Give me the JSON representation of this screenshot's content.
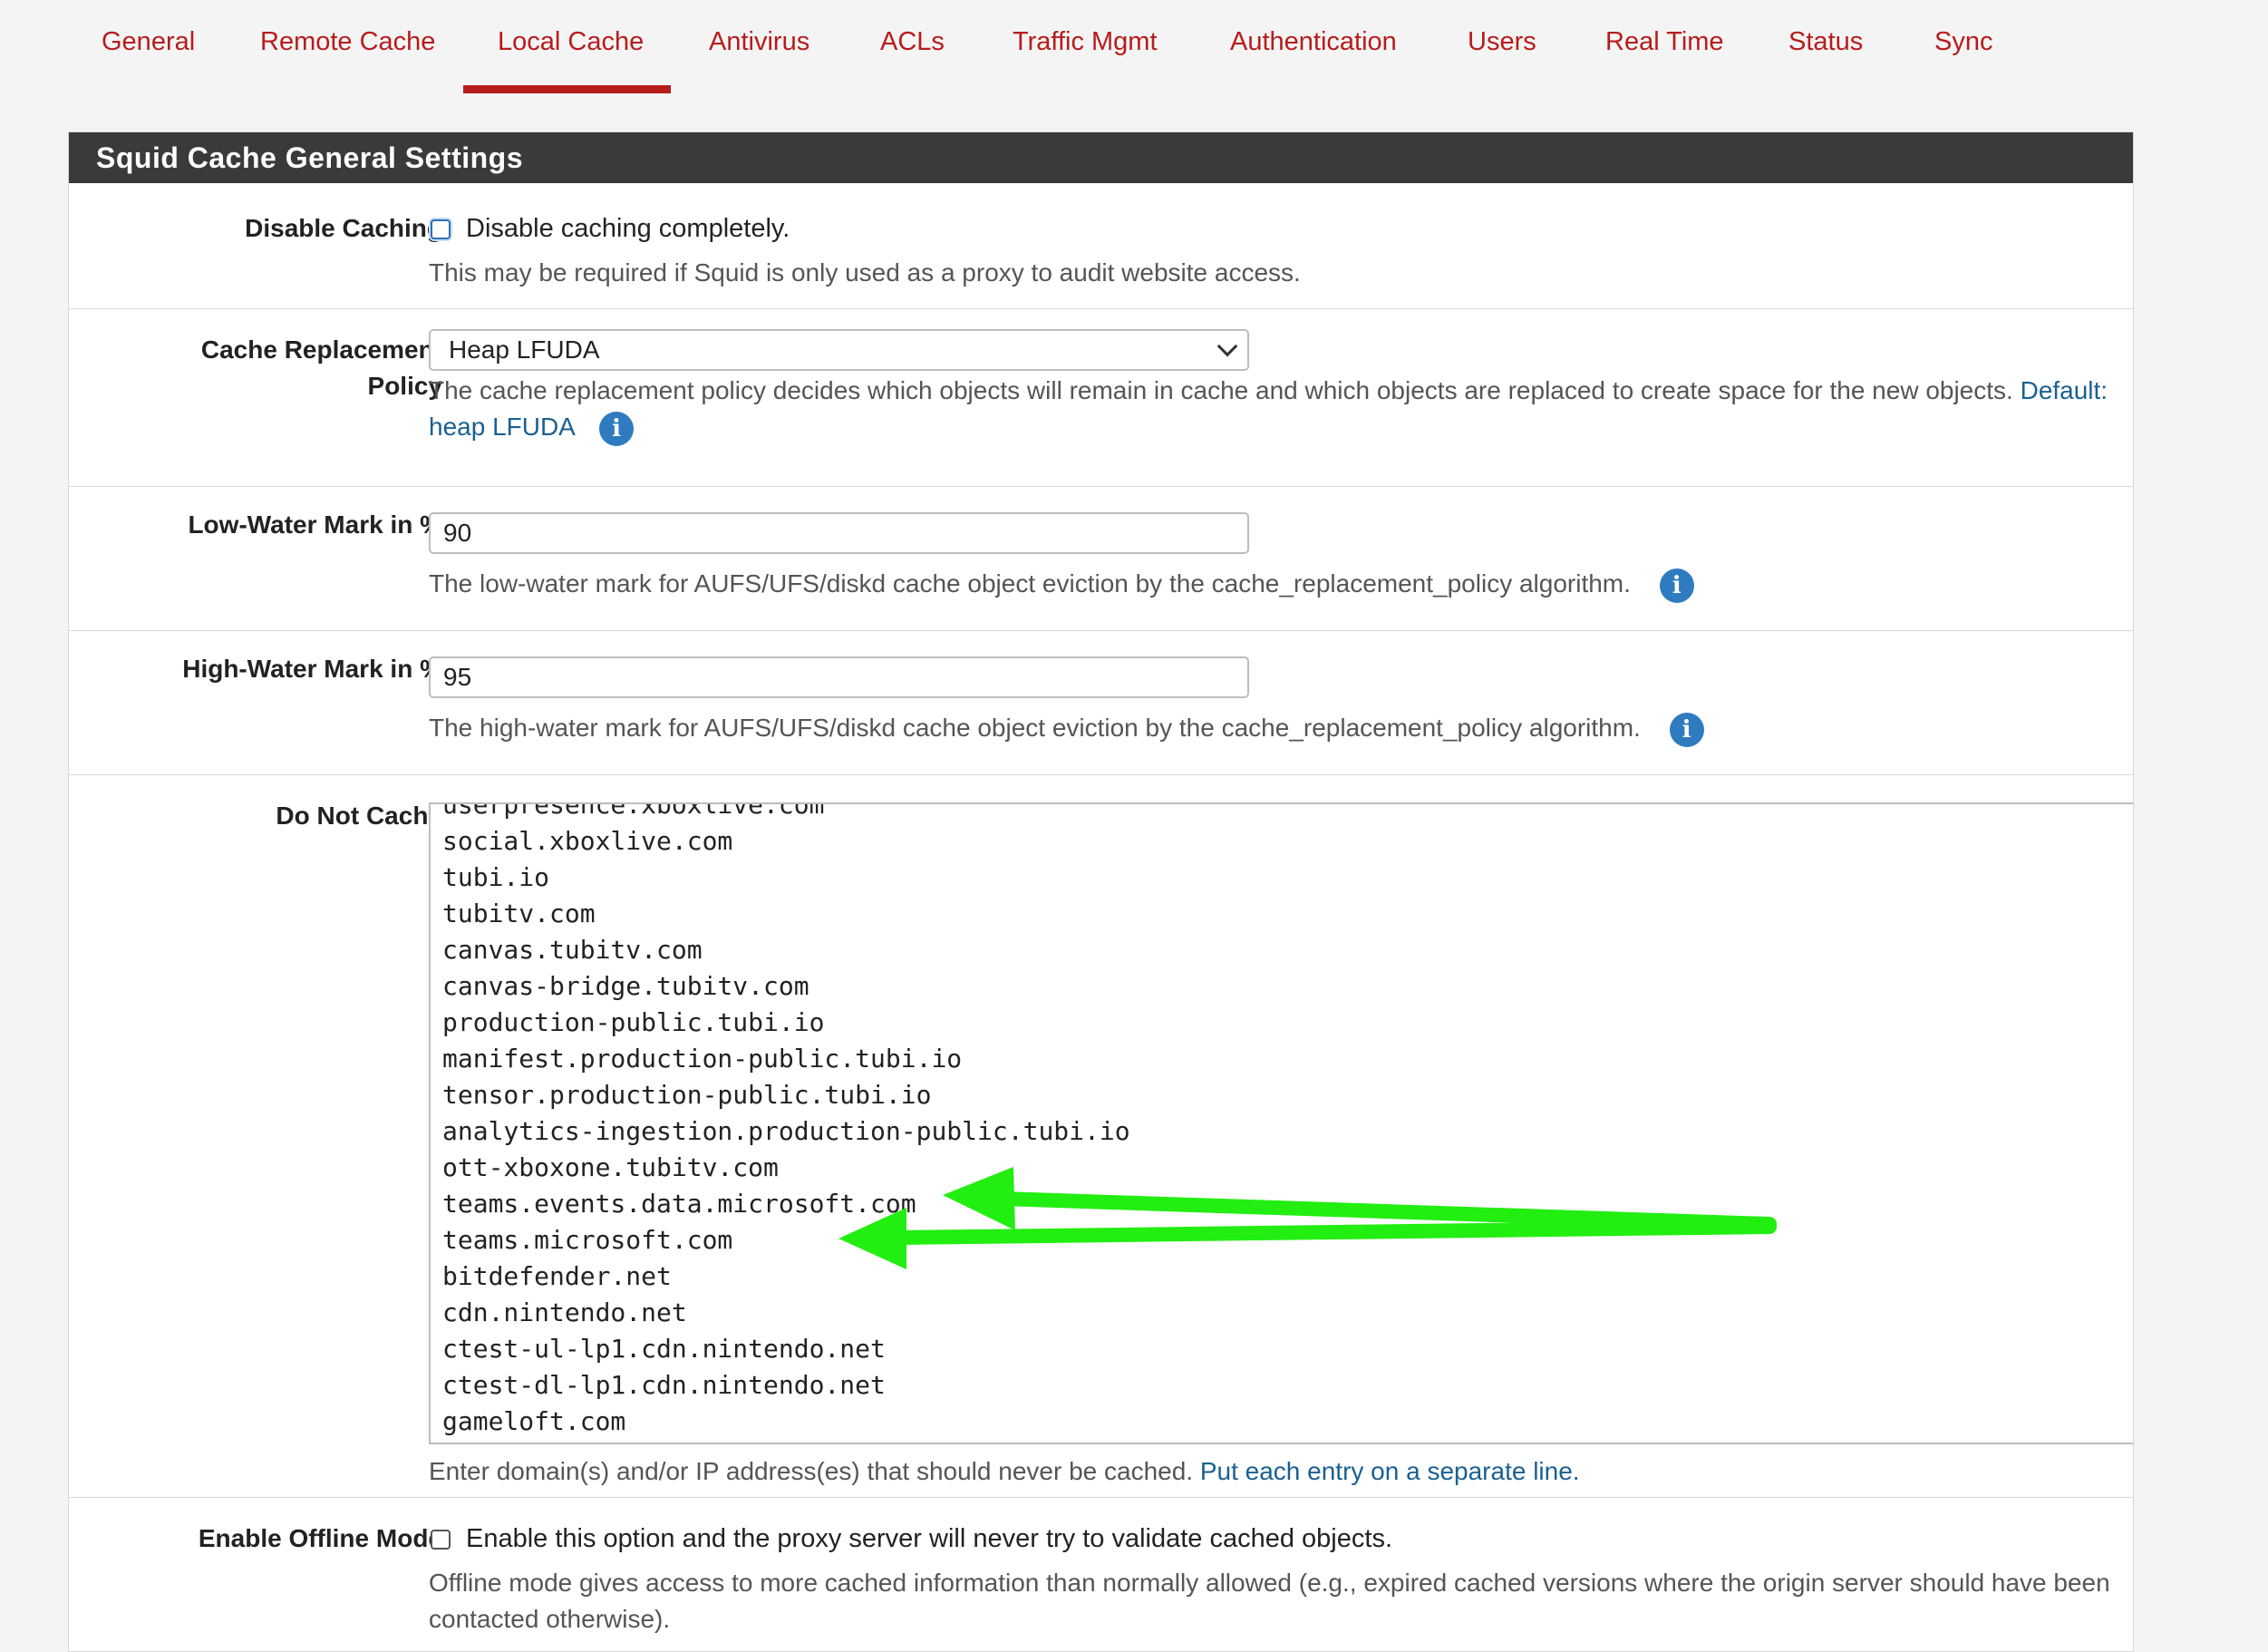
{
  "tabs": [
    {
      "label": "General"
    },
    {
      "label": "Remote Cache"
    },
    {
      "label": "Local Cache",
      "active": true
    },
    {
      "label": "Antivirus"
    },
    {
      "label": "ACLs"
    },
    {
      "label": "Traffic Mgmt"
    },
    {
      "label": "Authentication"
    },
    {
      "label": "Users"
    },
    {
      "label": "Real Time"
    },
    {
      "label": "Status"
    },
    {
      "label": "Sync"
    }
  ],
  "panel": {
    "title": "Squid Cache General Settings"
  },
  "disable_caching": {
    "label": "Disable Caching",
    "checkbox_label": "Disable caching completely.",
    "help": "This may be required if Squid is only used as a proxy to audit website access.",
    "checked": false
  },
  "cache_policy": {
    "label_line1": "Cache Replacement",
    "label_line2": "Policy",
    "value": "Heap LFUDA",
    "help": "The cache replacement policy decides which objects will remain in cache and which objects are replaced to create space for the new objects.",
    "default_prefix": "Default:",
    "default_value": "heap LFUDA"
  },
  "low_water": {
    "label": "Low-Water Mark in %",
    "value": "90",
    "help": "The low-water mark for AUFS/UFS/diskd cache object eviction by the cache_replacement_policy algorithm."
  },
  "high_water": {
    "label": "High-Water Mark in %",
    "value": "95",
    "help": "The high-water mark for AUFS/UFS/diskd cache object eviction by the cache_replacement_policy algorithm."
  },
  "do_not_cache": {
    "label": "Do Not Cache",
    "lines": [
      "userpresence.xboxlive.com",
      "social.xboxlive.com",
      "tubi.io",
      "tubitv.com",
      "canvas.tubitv.com",
      "canvas-bridge.tubitv.com",
      "production-public.tubi.io",
      "manifest.production-public.tubi.io",
      "tensor.production-public.tubi.io",
      "analytics-ingestion.production-public.tubi.io",
      "ott-xboxone.tubitv.com",
      "teams.events.data.microsoft.com",
      "teams.microsoft.com",
      "bitdefender.net",
      "cdn.nintendo.net",
      "ctest-ul-lp1.cdn.nintendo.net",
      "ctest-dl-lp1.cdn.nintendo.net",
      "gameloft.com"
    ],
    "help": "Enter domain(s) and/or IP address(es) that should never be cached.",
    "help_link": "Put each entry on a separate line."
  },
  "offline_mode": {
    "label": "Enable Offline Mode",
    "checkbox_label": "Enable this option and the proxy server will never try to validate cached objects.",
    "help_line1": "Offline mode gives access to more cached information than normally allowed (e.g., expired cached versions where the origin server should have been",
    "help_line2": "contacted otherwise).",
    "checked": false
  },
  "annotation": {
    "arrow_color": "#22ee11"
  }
}
